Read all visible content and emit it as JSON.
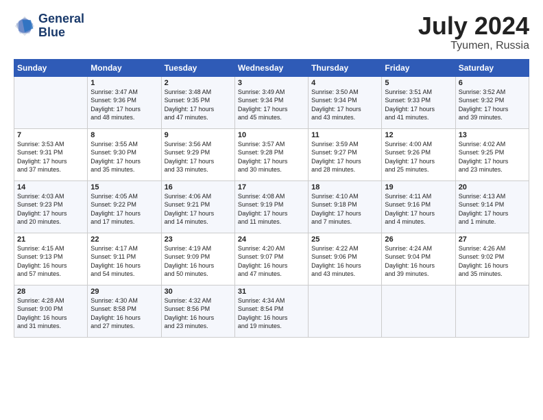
{
  "header": {
    "logo_line1": "General",
    "logo_line2": "Blue",
    "month_year": "July 2024",
    "location": "Tyumen, Russia"
  },
  "weekdays": [
    "Sunday",
    "Monday",
    "Tuesday",
    "Wednesday",
    "Thursday",
    "Friday",
    "Saturday"
  ],
  "weeks": [
    [
      {
        "day": "",
        "text": ""
      },
      {
        "day": "1",
        "text": "Sunrise: 3:47 AM\nSunset: 9:36 PM\nDaylight: 17 hours\nand 48 minutes."
      },
      {
        "day": "2",
        "text": "Sunrise: 3:48 AM\nSunset: 9:35 PM\nDaylight: 17 hours\nand 47 minutes."
      },
      {
        "day": "3",
        "text": "Sunrise: 3:49 AM\nSunset: 9:34 PM\nDaylight: 17 hours\nand 45 minutes."
      },
      {
        "day": "4",
        "text": "Sunrise: 3:50 AM\nSunset: 9:34 PM\nDaylight: 17 hours\nand 43 minutes."
      },
      {
        "day": "5",
        "text": "Sunrise: 3:51 AM\nSunset: 9:33 PM\nDaylight: 17 hours\nand 41 minutes."
      },
      {
        "day": "6",
        "text": "Sunrise: 3:52 AM\nSunset: 9:32 PM\nDaylight: 17 hours\nand 39 minutes."
      }
    ],
    [
      {
        "day": "7",
        "text": "Sunrise: 3:53 AM\nSunset: 9:31 PM\nDaylight: 17 hours\nand 37 minutes."
      },
      {
        "day": "8",
        "text": "Sunrise: 3:55 AM\nSunset: 9:30 PM\nDaylight: 17 hours\nand 35 minutes."
      },
      {
        "day": "9",
        "text": "Sunrise: 3:56 AM\nSunset: 9:29 PM\nDaylight: 17 hours\nand 33 minutes."
      },
      {
        "day": "10",
        "text": "Sunrise: 3:57 AM\nSunset: 9:28 PM\nDaylight: 17 hours\nand 30 minutes."
      },
      {
        "day": "11",
        "text": "Sunrise: 3:59 AM\nSunset: 9:27 PM\nDaylight: 17 hours\nand 28 minutes."
      },
      {
        "day": "12",
        "text": "Sunrise: 4:00 AM\nSunset: 9:26 PM\nDaylight: 17 hours\nand 25 minutes."
      },
      {
        "day": "13",
        "text": "Sunrise: 4:02 AM\nSunset: 9:25 PM\nDaylight: 17 hours\nand 23 minutes."
      }
    ],
    [
      {
        "day": "14",
        "text": "Sunrise: 4:03 AM\nSunset: 9:23 PM\nDaylight: 17 hours\nand 20 minutes."
      },
      {
        "day": "15",
        "text": "Sunrise: 4:05 AM\nSunset: 9:22 PM\nDaylight: 17 hours\nand 17 minutes."
      },
      {
        "day": "16",
        "text": "Sunrise: 4:06 AM\nSunset: 9:21 PM\nDaylight: 17 hours\nand 14 minutes."
      },
      {
        "day": "17",
        "text": "Sunrise: 4:08 AM\nSunset: 9:19 PM\nDaylight: 17 hours\nand 11 minutes."
      },
      {
        "day": "18",
        "text": "Sunrise: 4:10 AM\nSunset: 9:18 PM\nDaylight: 17 hours\nand 7 minutes."
      },
      {
        "day": "19",
        "text": "Sunrise: 4:11 AM\nSunset: 9:16 PM\nDaylight: 17 hours\nand 4 minutes."
      },
      {
        "day": "20",
        "text": "Sunrise: 4:13 AM\nSunset: 9:14 PM\nDaylight: 17 hours\nand 1 minute."
      }
    ],
    [
      {
        "day": "21",
        "text": "Sunrise: 4:15 AM\nSunset: 9:13 PM\nDaylight: 16 hours\nand 57 minutes."
      },
      {
        "day": "22",
        "text": "Sunrise: 4:17 AM\nSunset: 9:11 PM\nDaylight: 16 hours\nand 54 minutes."
      },
      {
        "day": "23",
        "text": "Sunrise: 4:19 AM\nSunset: 9:09 PM\nDaylight: 16 hours\nand 50 minutes."
      },
      {
        "day": "24",
        "text": "Sunrise: 4:20 AM\nSunset: 9:07 PM\nDaylight: 16 hours\nand 47 minutes."
      },
      {
        "day": "25",
        "text": "Sunrise: 4:22 AM\nSunset: 9:06 PM\nDaylight: 16 hours\nand 43 minutes."
      },
      {
        "day": "26",
        "text": "Sunrise: 4:24 AM\nSunset: 9:04 PM\nDaylight: 16 hours\nand 39 minutes."
      },
      {
        "day": "27",
        "text": "Sunrise: 4:26 AM\nSunset: 9:02 PM\nDaylight: 16 hours\nand 35 minutes."
      }
    ],
    [
      {
        "day": "28",
        "text": "Sunrise: 4:28 AM\nSunset: 9:00 PM\nDaylight: 16 hours\nand 31 minutes."
      },
      {
        "day": "29",
        "text": "Sunrise: 4:30 AM\nSunset: 8:58 PM\nDaylight: 16 hours\nand 27 minutes."
      },
      {
        "day": "30",
        "text": "Sunrise: 4:32 AM\nSunset: 8:56 PM\nDaylight: 16 hours\nand 23 minutes."
      },
      {
        "day": "31",
        "text": "Sunrise: 4:34 AM\nSunset: 8:54 PM\nDaylight: 16 hours\nand 19 minutes."
      },
      {
        "day": "",
        "text": ""
      },
      {
        "day": "",
        "text": ""
      },
      {
        "day": "",
        "text": ""
      }
    ]
  ]
}
